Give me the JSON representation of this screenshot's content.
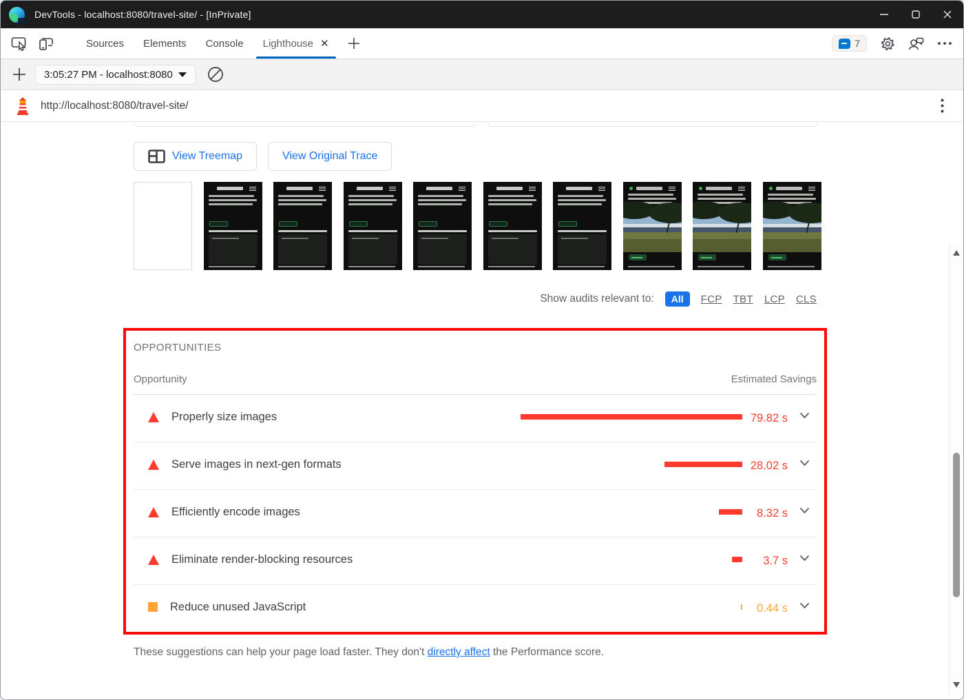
{
  "window": {
    "title": "DevTools - localhost:8080/travel-site/ - [InPrivate]",
    "controls": {
      "minimize": "minimize",
      "maximize": "maximize",
      "close": "close"
    }
  },
  "tab_bar": {
    "tabs": [
      {
        "label": "Sources",
        "active": false
      },
      {
        "label": "Elements",
        "active": false
      },
      {
        "label": "Console",
        "active": false
      },
      {
        "label": "Lighthouse",
        "active": true,
        "closable": true
      }
    ],
    "issues_count": "7"
  },
  "toolbar": {
    "session_selector": "3:05:27 PM - localhost:8080"
  },
  "url_bar": {
    "url": "http://localhost:8080/travel-site/"
  },
  "actions": {
    "view_treemap": "View Treemap",
    "view_original_trace": "View Original Trace"
  },
  "filmstrip": {
    "thumbnails": [
      "blank",
      "page",
      "page",
      "page",
      "page",
      "page",
      "page",
      "photo",
      "photo",
      "photo"
    ]
  },
  "audit_filter": {
    "label": "Show audits relevant to:",
    "options": [
      {
        "label": "All",
        "selected": true
      },
      {
        "label": "FCP",
        "selected": false
      },
      {
        "label": "TBT",
        "selected": false
      },
      {
        "label": "LCP",
        "selected": false
      },
      {
        "label": "CLS",
        "selected": false
      }
    ]
  },
  "opportunities": {
    "heading": "OPPORTUNITIES",
    "col_opportunity": "Opportunity",
    "col_savings": "Estimated Savings",
    "rows": [
      {
        "severity": "fail",
        "title": "Properly size images",
        "savings_s": 79.82,
        "savings_display": "79.82 s"
      },
      {
        "severity": "fail",
        "title": "Serve images in next-gen formats",
        "savings_s": 28.02,
        "savings_display": "28.02 s"
      },
      {
        "severity": "fail",
        "title": "Efficiently encode images",
        "savings_s": 8.32,
        "savings_display": "8.32 s"
      },
      {
        "severity": "fail",
        "title": "Eliminate render-blocking resources",
        "savings_s": 3.7,
        "savings_display": "3.7 s"
      },
      {
        "severity": "average",
        "title": "Reduce unused JavaScript",
        "savings_s": 0.44,
        "savings_display": "0.44 s"
      }
    ]
  },
  "footer": {
    "before_link": "These suggestions can help your page load faster. They don't ",
    "link_text": "directly affect",
    "after_link": " the Performance score."
  },
  "colors": {
    "fail": "#ff3b30",
    "average": "#ffa433",
    "accent_blue": "#1a73e8",
    "annotation_red": "#fd0808",
    "edge_underline": "#0067c0"
  }
}
